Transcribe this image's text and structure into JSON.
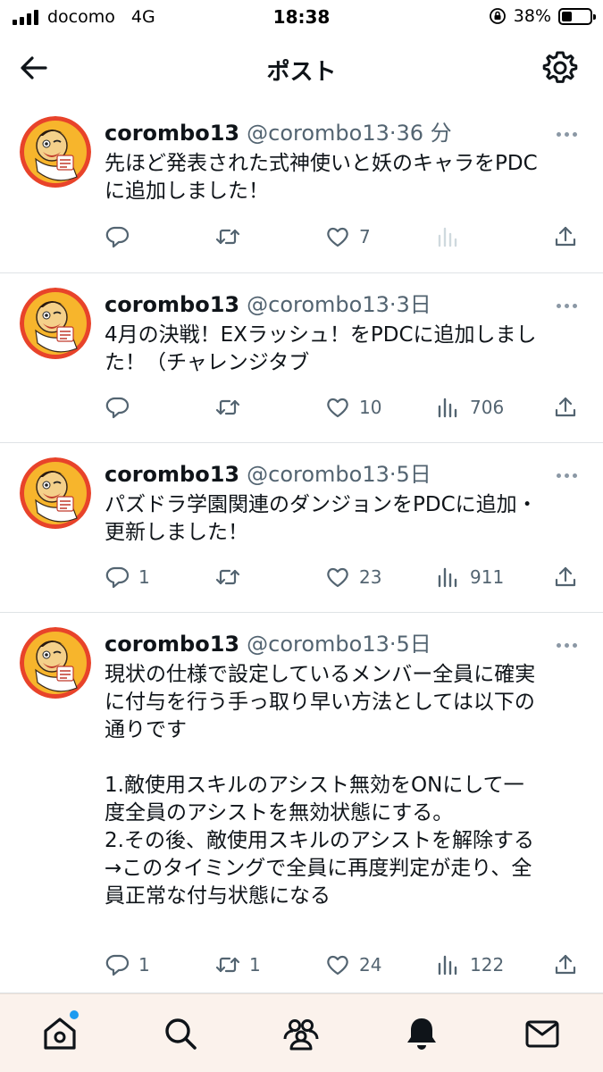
{
  "status_bar": {
    "carrier": "docomo",
    "network": "4G",
    "time": "18:38",
    "battery": "38%",
    "battery_level": 0.38
  },
  "header": {
    "title": "ポスト",
    "back_icon": "arrow-left-icon",
    "settings_icon": "gear-icon"
  },
  "tweets": [
    {
      "name": "corombo13",
      "handle": "@corombo13",
      "sep": "·",
      "time": "36 分",
      "text": "先ほど発表された式神使いと妖のキャラをPDC\nに追加しました！",
      "replies": "",
      "retweets": "",
      "likes": "7",
      "views": ""
    },
    {
      "name": "corombo13",
      "handle": "@corombo13",
      "sep": "·",
      "time": "3日",
      "text": "4月の決戦！EXラッシュ！をPDCに追加しまし\nた！（チャレンジタブ",
      "replies": "",
      "retweets": "",
      "likes": "10",
      "views": "706"
    },
    {
      "name": "corombo13",
      "handle": "@corombo13",
      "sep": "·",
      "time": "5日",
      "text": "パズドラ学園関連のダンジョンをPDCに追加・\n更新しました！",
      "replies": "1",
      "retweets": "",
      "likes": "23",
      "views": "911"
    },
    {
      "name": "corombo13",
      "handle": "@corombo13",
      "sep": "·",
      "time": "5日",
      "text": "現状の仕様で設定しているメンバー全員に確実\nに付与を行う手っ取り早い方法としては以下の\n通りです\n\n1.敵使用スキルのアシスト無効をONにして一\n度全員のアシストを無効状態にする。\n2.その後、敵使用スキルのアシストを解除する\n→このタイミングで全員に再度判定が走り、全\n員正常な付与状態になる",
      "replies": "1",
      "retweets": "1",
      "likes": "24",
      "views": "122"
    }
  ],
  "tabbar": {
    "items": [
      "home-icon",
      "search-icon",
      "communities-icon",
      "notifications-icon",
      "messages-icon"
    ]
  },
  "colors": {
    "text": "#0f1419",
    "secondary": "#536471",
    "divider": "#dfe3e6",
    "accent": "#1d9bf0",
    "tabbar_bg": "#fbf2ec"
  }
}
